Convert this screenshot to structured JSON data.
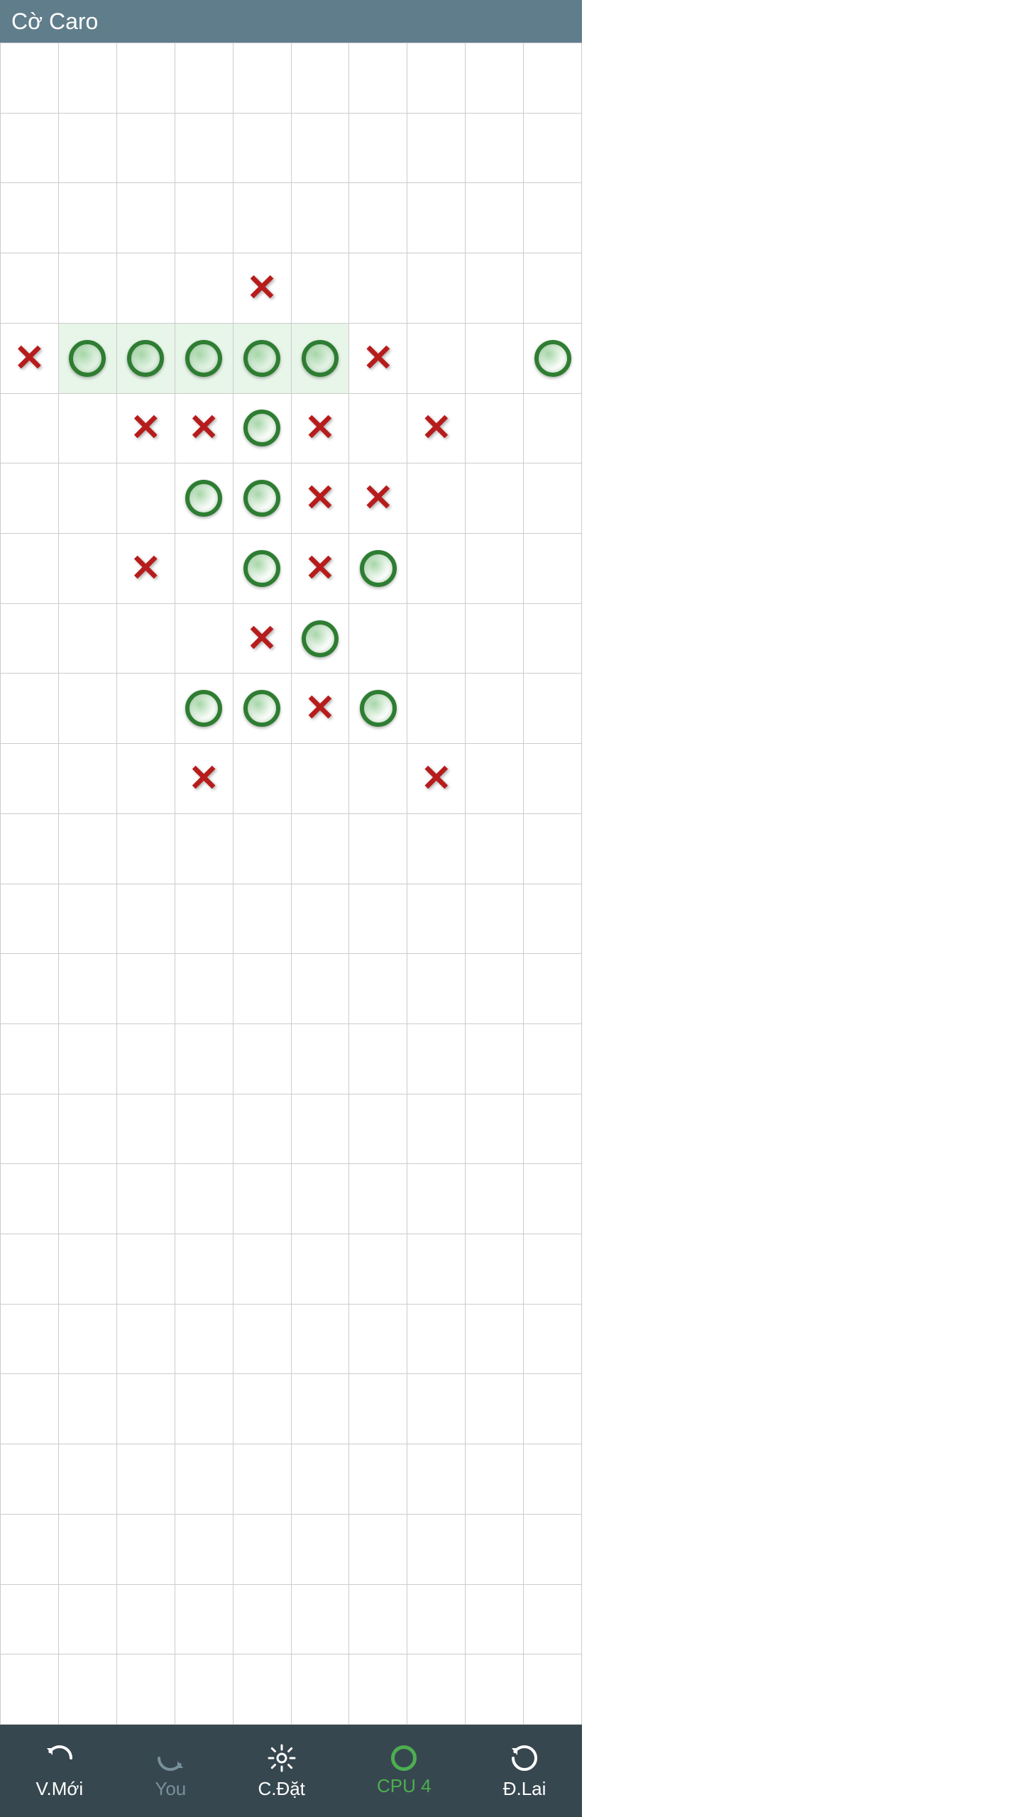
{
  "app": {
    "title": "Cờ Caro"
  },
  "footer": {
    "new_label": "V.Mới",
    "you_label": "You",
    "settings_label": "C.Đặt",
    "cpu_label": "CPU 4",
    "undo_label": "Đ.Lai"
  },
  "board": {
    "cols": 10,
    "rows": 24,
    "cells": [
      {
        "row": 4,
        "col": 5,
        "piece": "X",
        "highlight": false
      },
      {
        "row": 5,
        "col": 1,
        "piece": "X",
        "highlight": false
      },
      {
        "row": 5,
        "col": 2,
        "piece": "O",
        "highlight": true
      },
      {
        "row": 5,
        "col": 3,
        "piece": "O",
        "highlight": true
      },
      {
        "row": 5,
        "col": 4,
        "piece": "O",
        "highlight": true
      },
      {
        "row": 5,
        "col": 5,
        "piece": "O",
        "highlight": true
      },
      {
        "row": 5,
        "col": 6,
        "piece": "O",
        "highlight": true
      },
      {
        "row": 5,
        "col": 7,
        "piece": "X",
        "highlight": false
      },
      {
        "row": 5,
        "col": 10,
        "piece": "O",
        "highlight": false
      },
      {
        "row": 6,
        "col": 3,
        "piece": "X",
        "highlight": false
      },
      {
        "row": 6,
        "col": 4,
        "piece": "X",
        "highlight": false
      },
      {
        "row": 6,
        "col": 5,
        "piece": "O",
        "highlight": false
      },
      {
        "row": 6,
        "col": 6,
        "piece": "X",
        "highlight": false
      },
      {
        "row": 6,
        "col": 8,
        "piece": "X",
        "highlight": false
      },
      {
        "row": 7,
        "col": 4,
        "piece": "O",
        "highlight": false
      },
      {
        "row": 7,
        "col": 5,
        "piece": "O",
        "highlight": false
      },
      {
        "row": 7,
        "col": 6,
        "piece": "X",
        "highlight": false
      },
      {
        "row": 7,
        "col": 7,
        "piece": "X",
        "highlight": false
      },
      {
        "row": 8,
        "col": 3,
        "piece": "X",
        "highlight": false
      },
      {
        "row": 8,
        "col": 5,
        "piece": "O",
        "highlight": false
      },
      {
        "row": 8,
        "col": 6,
        "piece": "X",
        "highlight": false
      },
      {
        "row": 8,
        "col": 7,
        "piece": "O",
        "highlight": false
      },
      {
        "row": 9,
        "col": 5,
        "piece": "X",
        "highlight": false
      },
      {
        "row": 9,
        "col": 6,
        "piece": "O",
        "highlight": false
      },
      {
        "row": 10,
        "col": 4,
        "piece": "O",
        "highlight": false
      },
      {
        "row": 10,
        "col": 5,
        "piece": "O",
        "highlight": false
      },
      {
        "row": 10,
        "col": 6,
        "piece": "X",
        "highlight": false
      },
      {
        "row": 10,
        "col": 7,
        "piece": "O",
        "highlight": false
      },
      {
        "row": 11,
        "col": 4,
        "piece": "X",
        "highlight": false
      },
      {
        "row": 11,
        "col": 8,
        "piece": "X",
        "highlight": false
      }
    ]
  }
}
